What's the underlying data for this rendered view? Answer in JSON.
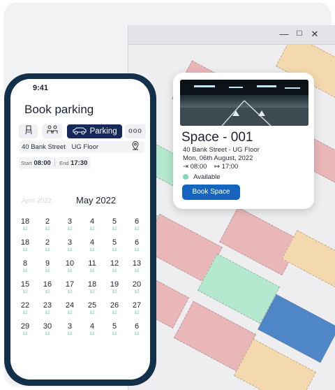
{
  "window": {
    "controls": [
      "—",
      "☐",
      "✕"
    ]
  },
  "space_card": {
    "title": "Space - 001",
    "address": "40 Bank Street - UG Floor",
    "date": "Mon, 06th August, 2022",
    "time_in": "08:00",
    "time_out": "17:00",
    "status": "Available",
    "book_label": "Book Space",
    "colors": {
      "button": "#1565c0",
      "available_dot": "#7fdcb8"
    }
  },
  "phone": {
    "status_time": "9:41",
    "heading": "Book parking",
    "categories": [
      {
        "name": "desk",
        "label": "",
        "icon": "chair-icon"
      },
      {
        "name": "meeting",
        "label": "",
        "icon": "people-icon"
      },
      {
        "name": "parking",
        "label": "Parking",
        "icon": "car-icon",
        "active": true
      },
      {
        "name": "more",
        "label": "ooo",
        "icon": "more-icon"
      }
    ],
    "location": {
      "building": "40 Bank Street",
      "floor": "UG Floor",
      "icon": "location-pin-icon"
    },
    "time_range": {
      "start_label": "Start",
      "start": "08:00",
      "end_label": "End",
      "end": "17:30"
    },
    "calendar": {
      "prev_month": "April 2022",
      "month": "May 2022",
      "weeks": [
        [
          [
            "18",
            "12"
          ],
          [
            "2",
            "12"
          ],
          [
            "3",
            "12"
          ],
          [
            "4",
            "12"
          ],
          [
            "5",
            "12"
          ],
          [
            "6",
            "12"
          ]
        ],
        [
          [
            "18",
            "12"
          ],
          [
            "2",
            "12"
          ],
          [
            "3",
            "12"
          ],
          [
            "4",
            "12"
          ],
          [
            "5",
            "12"
          ],
          [
            "6",
            "12"
          ]
        ],
        [
          [
            "8",
            "12"
          ],
          [
            "9",
            "12"
          ],
          [
            "10",
            "12"
          ],
          [
            "11",
            "12"
          ],
          [
            "12",
            "12"
          ],
          [
            "13",
            "12"
          ]
        ],
        [
          [
            "15",
            "12"
          ],
          [
            "16",
            "12"
          ],
          [
            "17",
            "12"
          ],
          [
            "18",
            "12"
          ],
          [
            "19",
            "12"
          ],
          [
            "20",
            "12"
          ]
        ],
        [
          [
            "22",
            "12"
          ],
          [
            "23",
            "12"
          ],
          [
            "24",
            "12"
          ],
          [
            "25",
            "12"
          ],
          [
            "26",
            "12"
          ],
          [
            "27",
            "12"
          ]
        ],
        [
          [
            "29",
            "12"
          ],
          [
            "30",
            "12"
          ],
          [
            "3",
            "12"
          ],
          [
            "4",
            "12"
          ],
          [
            "5",
            "12"
          ],
          [
            "6",
            "12"
          ]
        ]
      ]
    }
  },
  "colors": {
    "phone_frame": "#13304a",
    "active_pill": "#15285a",
    "available_count": "#5ec6a2"
  }
}
